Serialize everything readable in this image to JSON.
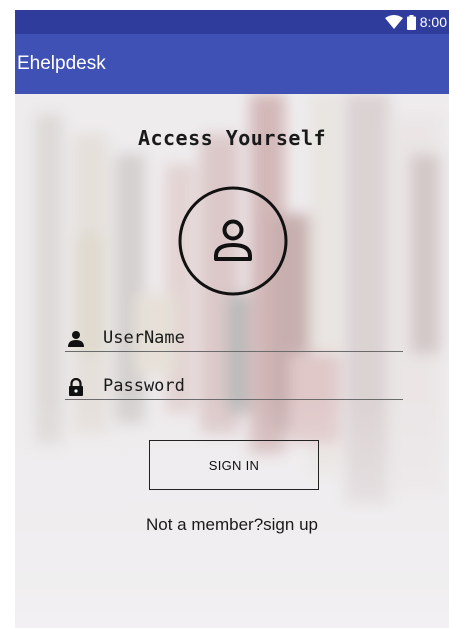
{
  "status_bar": {
    "time": "8:00",
    "icons": [
      "wifi-icon",
      "battery-icon"
    ]
  },
  "app_bar": {
    "title": "Ehelpdesk"
  },
  "login": {
    "heading": "Access Yourself",
    "avatar_icon": "user-icon",
    "username": {
      "placeholder": "UserName",
      "value": "",
      "icon": "person-icon"
    },
    "password": {
      "placeholder": "Password",
      "value": "",
      "icon": "lock-icon"
    },
    "signin_label": "SIGN IN",
    "signup_text": "Not a member?sign up"
  },
  "colors": {
    "status_bar": "#2f3c9c",
    "app_bar": "#3f51b5",
    "text": "#1a1a1a"
  }
}
